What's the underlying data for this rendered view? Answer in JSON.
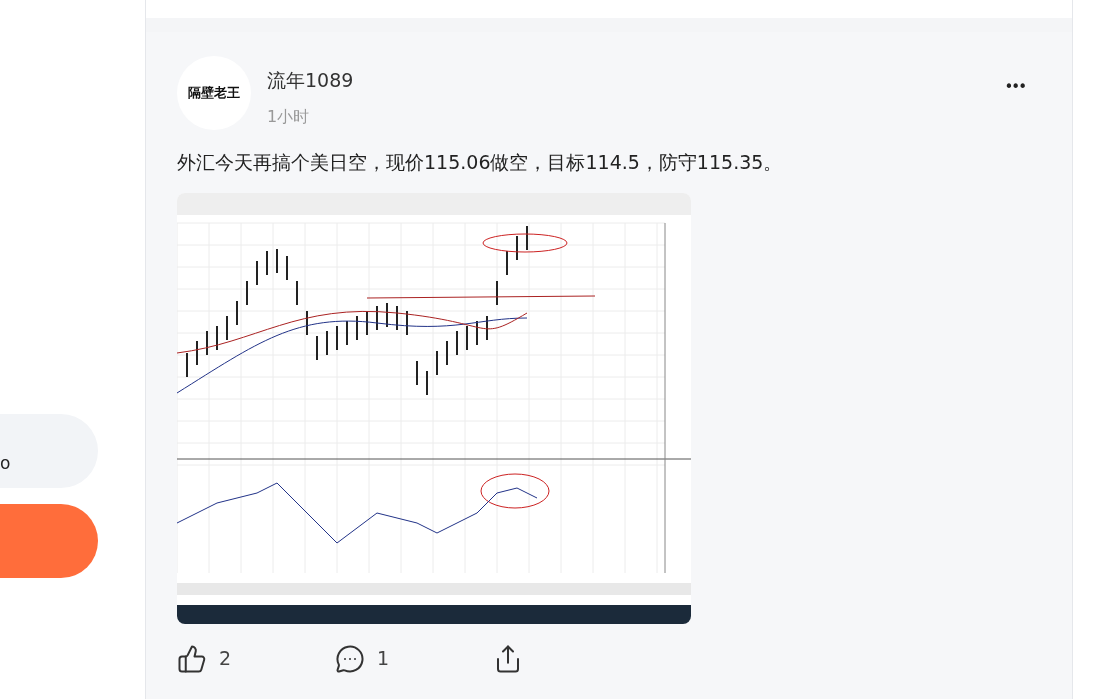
{
  "sidebar": {
    "buttons": [
      {
        "label": "o",
        "kind": "secondary"
      },
      {
        "kind": "primary"
      }
    ]
  },
  "post": {
    "avatar": {
      "text": "隔壁老王"
    },
    "author": "流年1089",
    "time": "1小时",
    "more": "•••",
    "text": "外汇今天再搞个美日空，现价115.06做空，目标114.5，防守115.35。",
    "actions": [
      {
        "kind": "like",
        "count": "2"
      },
      {
        "kind": "comment",
        "count": "1"
      },
      {
        "kind": "share"
      }
    ]
  }
}
